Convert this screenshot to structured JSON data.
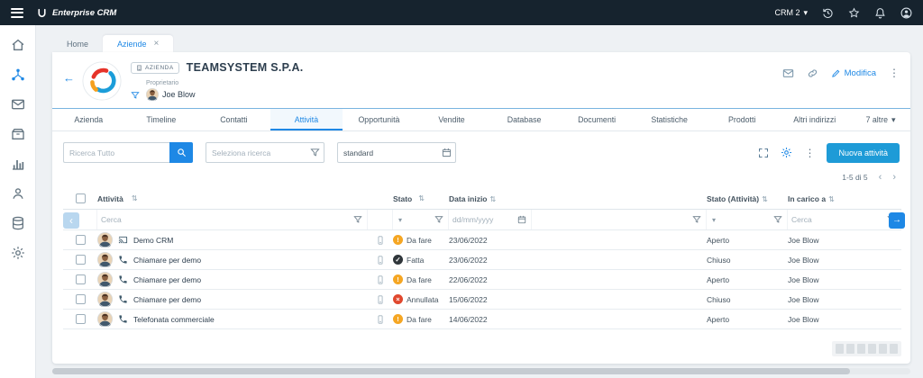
{
  "topbar": {
    "brand": "Enterprise CRM",
    "crm_selector": "CRM 2"
  },
  "icons": {
    "dots": "⋮",
    "caret": "▾",
    "close": "×",
    "back": "←",
    "sort": "⇅",
    "chev_left": "‹",
    "chev_right": "›",
    "arrow_right": "→"
  },
  "sidebar": {
    "items": [
      "home",
      "relations",
      "communications",
      "archive",
      "analytics",
      "support",
      "database",
      "settings"
    ],
    "active": "relations"
  },
  "window_tabs": {
    "home": "Home",
    "active": "Aziende"
  },
  "company": {
    "badge": "AZIENDA",
    "name": "TEAMSYSTEM S.P.A.",
    "owner_label": "Proprietario",
    "owner_name": "Joe Blow",
    "edit_label": "Modifica"
  },
  "nav": {
    "tabs": [
      "Azienda",
      "Timeline",
      "Contatti",
      "Attività",
      "Opportunità",
      "Vendite",
      "Database",
      "Documenti",
      "Statistiche",
      "Prodotti",
      "Altri indirizzi"
    ],
    "more": "7 altre",
    "active": "Attività"
  },
  "toolbar": {
    "search_placeholder": "Ricerca Tutto",
    "saved_search_placeholder": "Seleziona ricerca",
    "view_value": "standard",
    "new_button": "Nuova attività"
  },
  "pagination": {
    "text": "1-5 di 5"
  },
  "table": {
    "columns": [
      "Attività",
      "Stato",
      "Data inizio",
      "Stato (Attività)",
      "In carico a"
    ],
    "filters": {
      "search_placeholder": "Cerca",
      "date_placeholder": "dd/mm/yyyy",
      "assignee_placeholder": "Cerca"
    },
    "rows": [
      {
        "activity": "Demo CRM",
        "type": "demo",
        "status": "Da fare",
        "status_glyph": "!",
        "status_color": "#f5a623",
        "date": "23/06/2022",
        "state": "Aperto",
        "assignee": "Joe Blow"
      },
      {
        "activity": "Chiamare per demo",
        "type": "call",
        "status": "Fatta",
        "status_glyph": "✓",
        "status_color": "#30363b",
        "date": "23/06/2022",
        "state": "Chiuso",
        "assignee": "Joe Blow"
      },
      {
        "activity": "Chiamare per demo",
        "type": "call",
        "status": "Da fare",
        "status_glyph": "!",
        "status_color": "#f5a623",
        "date": "22/06/2022",
        "state": "Aperto",
        "assignee": "Joe Blow"
      },
      {
        "activity": "Chiamare per demo",
        "type": "call",
        "status": "Annullata",
        "status_glyph": "×",
        "status_color": "#e0482e",
        "date": "15/06/2022",
        "state": "Chiuso",
        "assignee": "Joe Blow"
      },
      {
        "activity": "Telefonata commerciale",
        "type": "call",
        "status": "Da fare",
        "status_glyph": "!",
        "status_color": "#f5a623",
        "date": "14/06/2022",
        "state": "Aperto",
        "assignee": "Joe Blow"
      }
    ]
  },
  "colors": {
    "accent": "#1e88e5",
    "topbar_bg": "#16232e",
    "status_todo": "#f5a623",
    "status_done": "#30363b",
    "status_cancelled": "#e0482e"
  }
}
